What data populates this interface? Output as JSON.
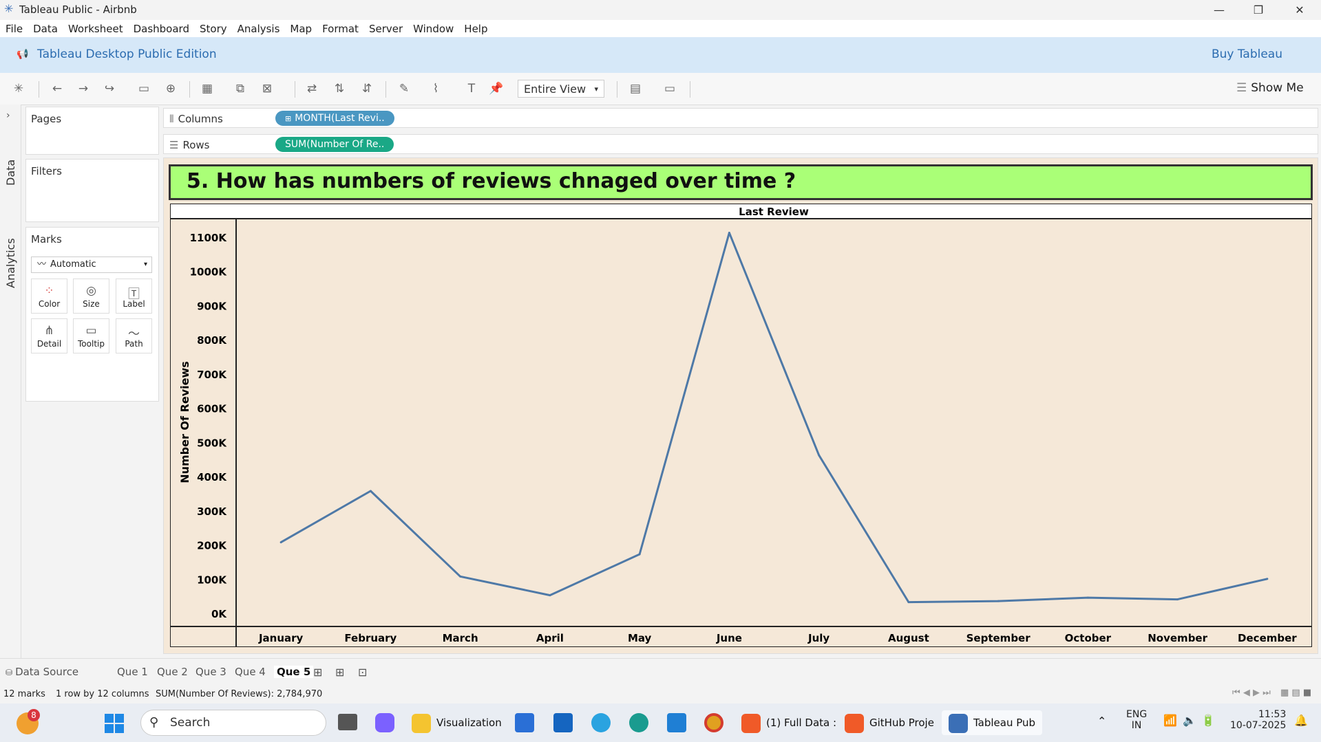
{
  "window": {
    "title": "Tableau Public - Airbnb",
    "controls": [
      "minimize-icon",
      "restore-icon",
      "close-icon"
    ]
  },
  "menu": [
    "File",
    "Data",
    "Worksheet",
    "Dashboard",
    "Story",
    "Analysis",
    "Map",
    "Format",
    "Server",
    "Window",
    "Help"
  ],
  "banner": {
    "title": "Tableau Desktop Public Edition",
    "buy": "Buy Tableau"
  },
  "toolbar": {
    "fit": "Entire View",
    "show_me": "Show Me"
  },
  "side_tabs": {
    "data": "Data",
    "analytics": "Analytics"
  },
  "cards": {
    "pages": "Pages",
    "filters": "Filters",
    "marks": "Marks",
    "mark_type": "Automatic",
    "mark_buttons": [
      {
        "label": "Color",
        "icon": "color-icon"
      },
      {
        "label": "Size",
        "icon": "size-icon"
      },
      {
        "label": "Label",
        "icon": "label-icon"
      },
      {
        "label": "Detail",
        "icon": "detail-icon"
      },
      {
        "label": "Tooltip",
        "icon": "tooltip-icon"
      },
      {
        "label": "Path",
        "icon": "path-icon"
      }
    ]
  },
  "shelves": {
    "columns_label": "Columns",
    "columns_pill": "MONTH(Last Revi..",
    "rows_label": "Rows",
    "rows_pill": "SUM(Number Of Re.."
  },
  "colors": {
    "columns_pill": "#4a97c2",
    "rows_pill": "#1aa886",
    "line": "#4e79a7",
    "title_bg": "#aaff77",
    "plot_bg": "#f5e8d8"
  },
  "view_title": "5. How has numbers of reviews chnaged over time ?",
  "chart_data": {
    "type": "line",
    "title": "5. How has numbers of reviews chnaged over time ?",
    "header": "Last Review",
    "ylabel": "Number Of Reviews",
    "categories": [
      "January",
      "February",
      "March",
      "April",
      "May",
      "June",
      "July",
      "August",
      "September",
      "October",
      "November",
      "December"
    ],
    "values": [
      210000,
      360000,
      110000,
      55000,
      175000,
      1115000,
      465000,
      35000,
      38000,
      48000,
      43000,
      103000
    ],
    "y_ticks": [
      "0K",
      "100K",
      "200K",
      "300K",
      "400K",
      "500K",
      "600K",
      "700K",
      "800K",
      "900K",
      "1000K",
      "1100K"
    ],
    "ylim": [
      0,
      1160000
    ],
    "grid": false
  },
  "sheets": {
    "data_source": "Data Source",
    "tabs": [
      "Que 1",
      "Que 2",
      "Que 3",
      "Que 4",
      "Que 5"
    ],
    "active": "Que 5"
  },
  "status": {
    "marks": "12 marks",
    "dims": "1 row by 12 columns",
    "sum": "SUM(Number Of Reviews): 2,784,970"
  },
  "taskbar": {
    "search": "Search",
    "badge": "8",
    "apps": [
      "Visualization",
      "(1) Full Data :",
      "GitHub Proje",
      "Tableau Pub"
    ],
    "lang1": "ENG",
    "lang2": "IN",
    "time": "11:53",
    "date": "10-07-2025"
  }
}
